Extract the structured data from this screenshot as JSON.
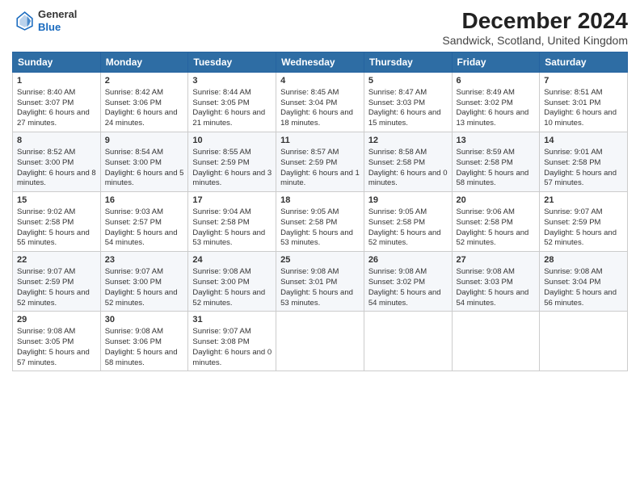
{
  "header": {
    "logo_line1": "General",
    "logo_line2": "Blue",
    "title": "December 2024",
    "subtitle": "Sandwick, Scotland, United Kingdom"
  },
  "weekdays": [
    "Sunday",
    "Monday",
    "Tuesday",
    "Wednesday",
    "Thursday",
    "Friday",
    "Saturday"
  ],
  "weeks": [
    [
      {
        "day": "1",
        "sunrise": "Sunrise: 8:40 AM",
        "sunset": "Sunset: 3:07 PM",
        "daylight": "Daylight: 6 hours and 27 minutes."
      },
      {
        "day": "2",
        "sunrise": "Sunrise: 8:42 AM",
        "sunset": "Sunset: 3:06 PM",
        "daylight": "Daylight: 6 hours and 24 minutes."
      },
      {
        "day": "3",
        "sunrise": "Sunrise: 8:44 AM",
        "sunset": "Sunset: 3:05 PM",
        "daylight": "Daylight: 6 hours and 21 minutes."
      },
      {
        "day": "4",
        "sunrise": "Sunrise: 8:45 AM",
        "sunset": "Sunset: 3:04 PM",
        "daylight": "Daylight: 6 hours and 18 minutes."
      },
      {
        "day": "5",
        "sunrise": "Sunrise: 8:47 AM",
        "sunset": "Sunset: 3:03 PM",
        "daylight": "Daylight: 6 hours and 15 minutes."
      },
      {
        "day": "6",
        "sunrise": "Sunrise: 8:49 AM",
        "sunset": "Sunset: 3:02 PM",
        "daylight": "Daylight: 6 hours and 13 minutes."
      },
      {
        "day": "7",
        "sunrise": "Sunrise: 8:51 AM",
        "sunset": "Sunset: 3:01 PM",
        "daylight": "Daylight: 6 hours and 10 minutes."
      }
    ],
    [
      {
        "day": "8",
        "sunrise": "Sunrise: 8:52 AM",
        "sunset": "Sunset: 3:00 PM",
        "daylight": "Daylight: 6 hours and 8 minutes."
      },
      {
        "day": "9",
        "sunrise": "Sunrise: 8:54 AM",
        "sunset": "Sunset: 3:00 PM",
        "daylight": "Daylight: 6 hours and 5 minutes."
      },
      {
        "day": "10",
        "sunrise": "Sunrise: 8:55 AM",
        "sunset": "Sunset: 2:59 PM",
        "daylight": "Daylight: 6 hours and 3 minutes."
      },
      {
        "day": "11",
        "sunrise": "Sunrise: 8:57 AM",
        "sunset": "Sunset: 2:59 PM",
        "daylight": "Daylight: 6 hours and 1 minute."
      },
      {
        "day": "12",
        "sunrise": "Sunrise: 8:58 AM",
        "sunset": "Sunset: 2:58 PM",
        "daylight": "Daylight: 6 hours and 0 minutes."
      },
      {
        "day": "13",
        "sunrise": "Sunrise: 8:59 AM",
        "sunset": "Sunset: 2:58 PM",
        "daylight": "Daylight: 5 hours and 58 minutes."
      },
      {
        "day": "14",
        "sunrise": "Sunrise: 9:01 AM",
        "sunset": "Sunset: 2:58 PM",
        "daylight": "Daylight: 5 hours and 57 minutes."
      }
    ],
    [
      {
        "day": "15",
        "sunrise": "Sunrise: 9:02 AM",
        "sunset": "Sunset: 2:58 PM",
        "daylight": "Daylight: 5 hours and 55 minutes."
      },
      {
        "day": "16",
        "sunrise": "Sunrise: 9:03 AM",
        "sunset": "Sunset: 2:57 PM",
        "daylight": "Daylight: 5 hours and 54 minutes."
      },
      {
        "day": "17",
        "sunrise": "Sunrise: 9:04 AM",
        "sunset": "Sunset: 2:58 PM",
        "daylight": "Daylight: 5 hours and 53 minutes."
      },
      {
        "day": "18",
        "sunrise": "Sunrise: 9:05 AM",
        "sunset": "Sunset: 2:58 PM",
        "daylight": "Daylight: 5 hours and 53 minutes."
      },
      {
        "day": "19",
        "sunrise": "Sunrise: 9:05 AM",
        "sunset": "Sunset: 2:58 PM",
        "daylight": "Daylight: 5 hours and 52 minutes."
      },
      {
        "day": "20",
        "sunrise": "Sunrise: 9:06 AM",
        "sunset": "Sunset: 2:58 PM",
        "daylight": "Daylight: 5 hours and 52 minutes."
      },
      {
        "day": "21",
        "sunrise": "Sunrise: 9:07 AM",
        "sunset": "Sunset: 2:59 PM",
        "daylight": "Daylight: 5 hours and 52 minutes."
      }
    ],
    [
      {
        "day": "22",
        "sunrise": "Sunrise: 9:07 AM",
        "sunset": "Sunset: 2:59 PM",
        "daylight": "Daylight: 5 hours and 52 minutes."
      },
      {
        "day": "23",
        "sunrise": "Sunrise: 9:07 AM",
        "sunset": "Sunset: 3:00 PM",
        "daylight": "Daylight: 5 hours and 52 minutes."
      },
      {
        "day": "24",
        "sunrise": "Sunrise: 9:08 AM",
        "sunset": "Sunset: 3:00 PM",
        "daylight": "Daylight: 5 hours and 52 minutes."
      },
      {
        "day": "25",
        "sunrise": "Sunrise: 9:08 AM",
        "sunset": "Sunset: 3:01 PM",
        "daylight": "Daylight: 5 hours and 53 minutes."
      },
      {
        "day": "26",
        "sunrise": "Sunrise: 9:08 AM",
        "sunset": "Sunset: 3:02 PM",
        "daylight": "Daylight: 5 hours and 54 minutes."
      },
      {
        "day": "27",
        "sunrise": "Sunrise: 9:08 AM",
        "sunset": "Sunset: 3:03 PM",
        "daylight": "Daylight: 5 hours and 54 minutes."
      },
      {
        "day": "28",
        "sunrise": "Sunrise: 9:08 AM",
        "sunset": "Sunset: 3:04 PM",
        "daylight": "Daylight: 5 hours and 56 minutes."
      }
    ],
    [
      {
        "day": "29",
        "sunrise": "Sunrise: 9:08 AM",
        "sunset": "Sunset: 3:05 PM",
        "daylight": "Daylight: 5 hours and 57 minutes."
      },
      {
        "day": "30",
        "sunrise": "Sunrise: 9:08 AM",
        "sunset": "Sunset: 3:06 PM",
        "daylight": "Daylight: 5 hours and 58 minutes."
      },
      {
        "day": "31",
        "sunrise": "Sunrise: 9:07 AM",
        "sunset": "Sunset: 3:08 PM",
        "daylight": "Daylight: 6 hours and 0 minutes."
      },
      null,
      null,
      null,
      null
    ]
  ]
}
